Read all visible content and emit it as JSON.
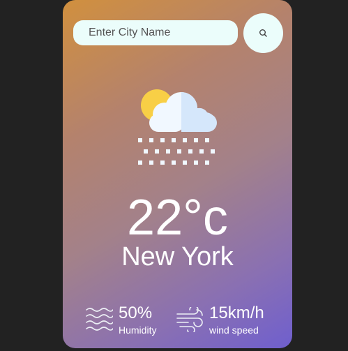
{
  "search": {
    "placeholder": "Enter City Name",
    "value": "",
    "button_icon": "search-icon"
  },
  "weather": {
    "icon": "snow-cloud-sun-icon",
    "temperature": "22°c",
    "city": "New York"
  },
  "details": {
    "humidity": {
      "icon": "humidity-waves-icon",
      "value": "50%",
      "label": "Humidity"
    },
    "wind": {
      "icon": "wind-icon",
      "value": "15km/h",
      "label": "wind speed"
    }
  },
  "colors": {
    "background": "#222222",
    "gradient_start": "#d1903e",
    "gradient_end": "#6f5fce",
    "input_background": "#ebfdfb",
    "text": "#ffffff"
  }
}
